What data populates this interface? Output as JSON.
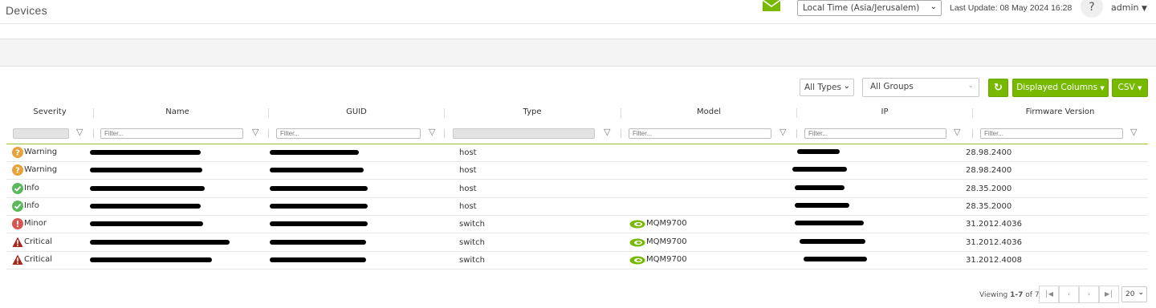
{
  "header": {
    "title": "Devices",
    "timezone": "Local Time (Asia/Jerusalem)",
    "last_update": "Last Update: 08 May 2024 16:28",
    "help": "?",
    "user": "admin"
  },
  "toolbar": {
    "types": "All Types",
    "groups": "All Groups",
    "displayed_columns": "Displayed Columns",
    "csv": "CSV"
  },
  "columns": [
    "Severity",
    "Name",
    "GUID",
    "Type",
    "Model",
    "IP",
    "Firmware Version"
  ],
  "filter_placeholder": "Filter...",
  "severity_colors": {
    "Warning": "#e8a23b",
    "Info": "#5cb85c",
    "Minor": "#d9534f",
    "Critical": "#a32a1f"
  },
  "accent": "#76b900",
  "rows": [
    {
      "severity": "Warning",
      "severity_icon": "warning-question-icon",
      "type": "host",
      "model": "",
      "firmware": "28.98.2400"
    },
    {
      "severity": "Warning",
      "severity_icon": "warning-question-icon",
      "type": "host",
      "model": "",
      "firmware": "28.98.2400"
    },
    {
      "severity": "Info",
      "severity_icon": "check-circle-icon",
      "type": "host",
      "model": "",
      "firmware": "28.35.2000"
    },
    {
      "severity": "Info",
      "severity_icon": "check-circle-icon",
      "type": "host",
      "model": "",
      "firmware": "28.35.2000"
    },
    {
      "severity": "Minor",
      "severity_icon": "exclamation-circle-icon",
      "type": "switch",
      "model": "MQM9700",
      "firmware": "31.2012.4036"
    },
    {
      "severity": "Critical",
      "severity_icon": "warning-triangle-icon",
      "type": "switch",
      "model": "MQM9700",
      "firmware": "31.2012.4036"
    },
    {
      "severity": "Critical",
      "severity_icon": "warning-triangle-icon",
      "type": "switch",
      "model": "MQM9700",
      "firmware": "31.2012.4008"
    }
  ],
  "footer": {
    "viewing_label": "Viewing",
    "viewing_range": "1-7",
    "viewing_of": "of",
    "viewing_total": "7",
    "page_size": "20"
  }
}
